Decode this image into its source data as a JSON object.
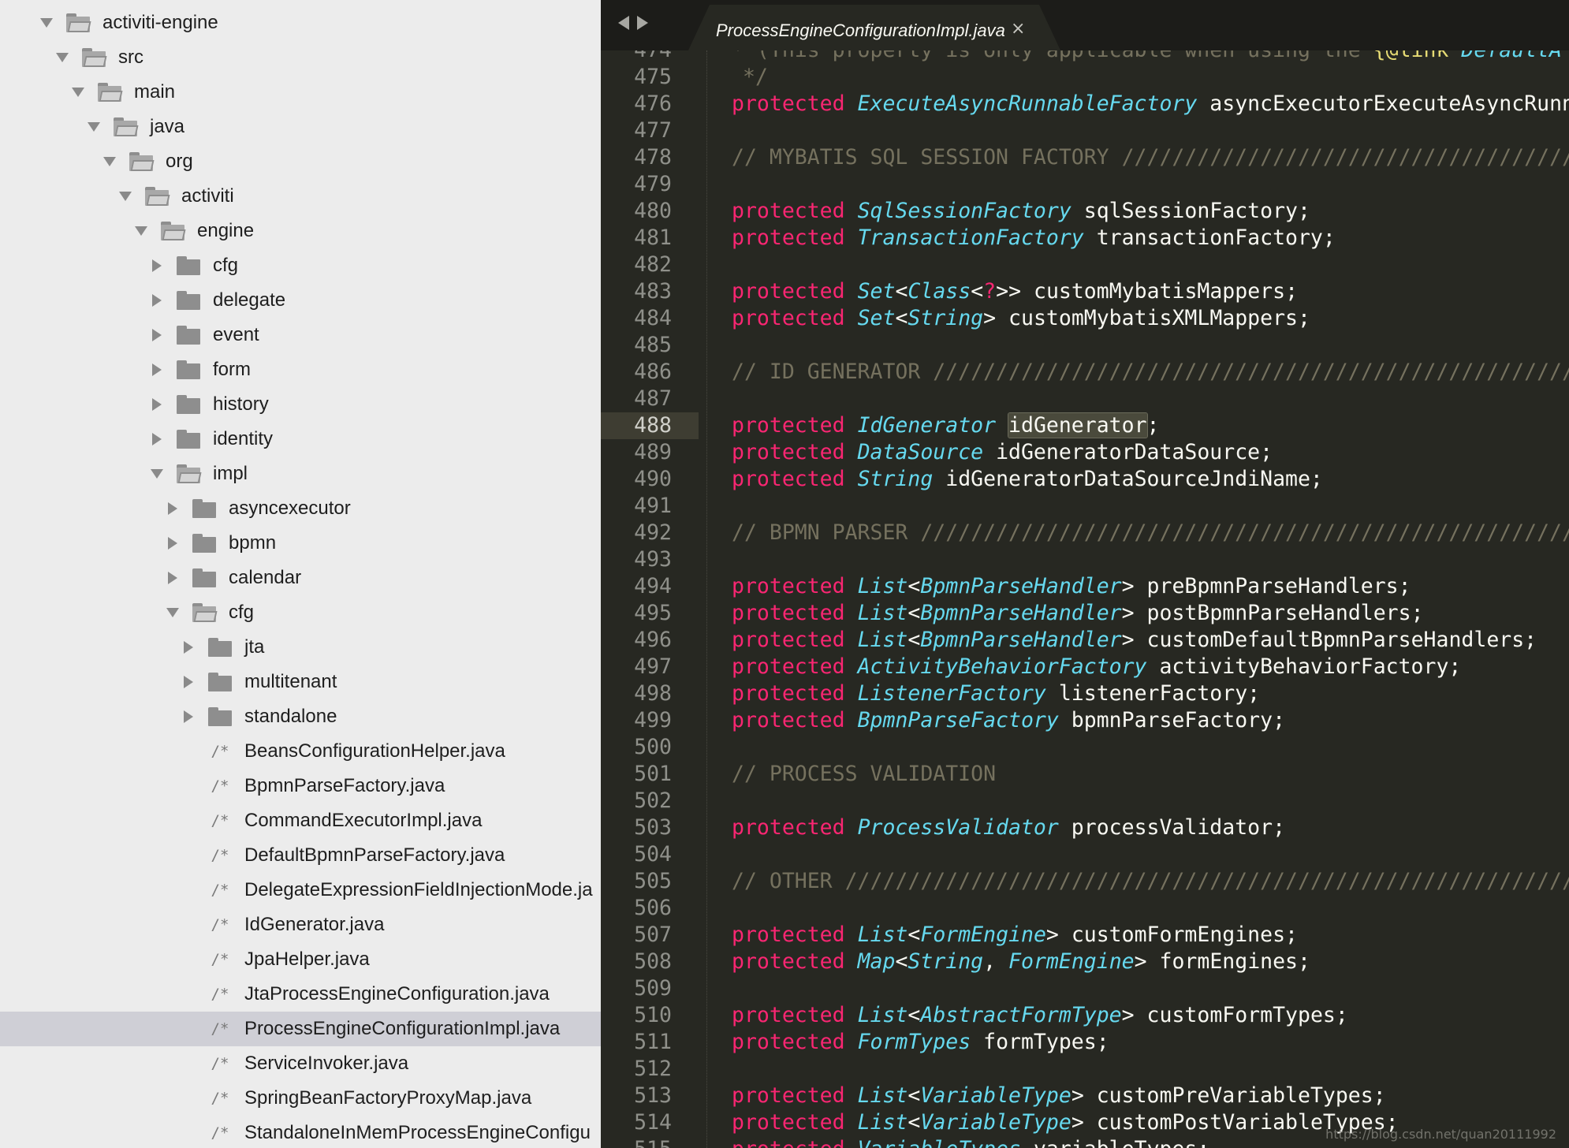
{
  "sidebar": {
    "items": [
      {
        "label": "activiti-engine",
        "kind": "folder",
        "open": true,
        "depth": 0
      },
      {
        "label": "src",
        "kind": "folder",
        "open": true,
        "depth": 1
      },
      {
        "label": "main",
        "kind": "folder",
        "open": true,
        "depth": 2
      },
      {
        "label": "java",
        "kind": "folder",
        "open": true,
        "depth": 3
      },
      {
        "label": "org",
        "kind": "folder",
        "open": true,
        "depth": 4
      },
      {
        "label": "activiti",
        "kind": "folder",
        "open": true,
        "depth": 5
      },
      {
        "label": "engine",
        "kind": "folder",
        "open": true,
        "depth": 6
      },
      {
        "label": "cfg",
        "kind": "folder",
        "open": false,
        "depth": 7
      },
      {
        "label": "delegate",
        "kind": "folder",
        "open": false,
        "depth": 7
      },
      {
        "label": "event",
        "kind": "folder",
        "open": false,
        "depth": 7
      },
      {
        "label": "form",
        "kind": "folder",
        "open": false,
        "depth": 7
      },
      {
        "label": "history",
        "kind": "folder",
        "open": false,
        "depth": 7
      },
      {
        "label": "identity",
        "kind": "folder",
        "open": false,
        "depth": 7
      },
      {
        "label": "impl",
        "kind": "folder",
        "open": true,
        "depth": 7
      },
      {
        "label": "asyncexecutor",
        "kind": "folder",
        "open": false,
        "depth": 8
      },
      {
        "label": "bpmn",
        "kind": "folder",
        "open": false,
        "depth": 8
      },
      {
        "label": "calendar",
        "kind": "folder",
        "open": false,
        "depth": 8
      },
      {
        "label": "cfg",
        "kind": "folder",
        "open": true,
        "depth": 8
      },
      {
        "label": "jta",
        "kind": "folder",
        "open": false,
        "depth": 9
      },
      {
        "label": "multitenant",
        "kind": "folder",
        "open": false,
        "depth": 9
      },
      {
        "label": "standalone",
        "kind": "folder",
        "open": false,
        "depth": 9
      },
      {
        "label": "BeansConfigurationHelper.java",
        "kind": "file",
        "depth": 9
      },
      {
        "label": "BpmnParseFactory.java",
        "kind": "file",
        "depth": 9
      },
      {
        "label": "CommandExecutorImpl.java",
        "kind": "file",
        "depth": 9
      },
      {
        "label": "DefaultBpmnParseFactory.java",
        "kind": "file",
        "depth": 9
      },
      {
        "label": "DelegateExpressionFieldInjectionMode.ja",
        "kind": "file",
        "depth": 9
      },
      {
        "label": "IdGenerator.java",
        "kind": "file",
        "depth": 9
      },
      {
        "label": "JpaHelper.java",
        "kind": "file",
        "depth": 9
      },
      {
        "label": "JtaProcessEngineConfiguration.java",
        "kind": "file",
        "depth": 9
      },
      {
        "label": "ProcessEngineConfigurationImpl.java",
        "kind": "file",
        "depth": 9,
        "selected": true
      },
      {
        "label": "ServiceInvoker.java",
        "kind": "file",
        "depth": 9
      },
      {
        "label": "SpringBeanFactoryProxyMap.java",
        "kind": "file",
        "depth": 9
      },
      {
        "label": "StandaloneInMemProcessEngineConfigu",
        "kind": "file",
        "depth": 9
      }
    ],
    "file_icon_glyph": "/*",
    "icons": {
      "folder": "folder-icon",
      "folder_open": "folder-open-icon",
      "file": "source-file-icon",
      "expand": "disclosure-triangle-icon"
    }
  },
  "tab": {
    "title": "ProcessEngineConfigurationImpl.java",
    "close_glyph": "×",
    "back_icon": "nav-back-icon",
    "forward_icon": "nav-forward-icon"
  },
  "editor": {
    "current_line": 488,
    "lines": [
      {
        "n": 474,
        "t": [
          [
            "cm",
            "* (This property is only applicable when using the "
          ],
          [
            "ti",
            "{@link"
          ],
          [
            "ty",
            " DefaultA"
          ]
        ]
      },
      {
        "n": 475,
        "t": [
          [
            "cm",
            "*/"
          ]
        ],
        "indent": true
      },
      {
        "n": 476,
        "t": [
          [
            "kw",
            "protected"
          ],
          [
            "p",
            " "
          ],
          [
            "ty",
            "ExecuteAsyncRunnableFactory"
          ],
          [
            "p",
            " asyncExecutorExecuteAsyncRunn"
          ]
        ]
      },
      {
        "n": 477,
        "t": []
      },
      {
        "n": 478,
        "t": [
          [
            "cm",
            "// MYBATIS SQL SESSION FACTORY //////////////////////////////////////"
          ]
        ]
      },
      {
        "n": 479,
        "t": []
      },
      {
        "n": 480,
        "t": [
          [
            "kw",
            "protected"
          ],
          [
            "p",
            " "
          ],
          [
            "ty",
            "SqlSessionFactory"
          ],
          [
            "p",
            " sqlSessionFactory;"
          ]
        ]
      },
      {
        "n": 481,
        "t": [
          [
            "kw",
            "protected"
          ],
          [
            "p",
            " "
          ],
          [
            "ty",
            "TransactionFactory"
          ],
          [
            "p",
            " transactionFactory;"
          ]
        ]
      },
      {
        "n": 482,
        "t": []
      },
      {
        "n": 483,
        "t": [
          [
            "kw",
            "protected"
          ],
          [
            "p",
            " "
          ],
          [
            "ty",
            "Set"
          ],
          [
            "p",
            "<"
          ],
          [
            "ty",
            "Class"
          ],
          [
            "p",
            "<"
          ],
          [
            "kw",
            "?"
          ],
          [
            "p",
            ">> customMybatisMappers;"
          ]
        ]
      },
      {
        "n": 484,
        "t": [
          [
            "kw",
            "protected"
          ],
          [
            "p",
            " "
          ],
          [
            "ty",
            "Set"
          ],
          [
            "p",
            "<"
          ],
          [
            "ty",
            "String"
          ],
          [
            "p",
            "> customMybatisXMLMappers;"
          ]
        ]
      },
      {
        "n": 485,
        "t": []
      },
      {
        "n": 486,
        "t": [
          [
            "cm",
            "// ID GENERATOR ///////////////////////////////////////////////////////"
          ]
        ]
      },
      {
        "n": 487,
        "t": []
      },
      {
        "n": 488,
        "t": [
          [
            "kw",
            "protected"
          ],
          [
            "p",
            " "
          ],
          [
            "ty",
            "IdGenerator"
          ],
          [
            "p",
            " "
          ],
          [
            "hl",
            "idGenerator"
          ],
          [
            "p",
            ";"
          ]
        ]
      },
      {
        "n": 489,
        "t": [
          [
            "kw",
            "protected"
          ],
          [
            "p",
            " "
          ],
          [
            "ty",
            "DataSource"
          ],
          [
            "p",
            " idGeneratorDataSource;"
          ]
        ]
      },
      {
        "n": 490,
        "t": [
          [
            "kw",
            "protected"
          ],
          [
            "p",
            " "
          ],
          [
            "ty",
            "String"
          ],
          [
            "p",
            " idGeneratorDataSourceJndiName;"
          ]
        ]
      },
      {
        "n": 491,
        "t": []
      },
      {
        "n": 492,
        "t": [
          [
            "cm",
            "// BPMN PARSER /////////////////////////////////////////////////////////"
          ]
        ]
      },
      {
        "n": 493,
        "t": []
      },
      {
        "n": 494,
        "t": [
          [
            "kw",
            "protected"
          ],
          [
            "p",
            " "
          ],
          [
            "ty",
            "List"
          ],
          [
            "p",
            "<"
          ],
          [
            "ty",
            "BpmnParseHandler"
          ],
          [
            "p",
            "> preBpmnParseHandlers;"
          ]
        ]
      },
      {
        "n": 495,
        "t": [
          [
            "kw",
            "protected"
          ],
          [
            "p",
            " "
          ],
          [
            "ty",
            "List"
          ],
          [
            "p",
            "<"
          ],
          [
            "ty",
            "BpmnParseHandler"
          ],
          [
            "p",
            "> postBpmnParseHandlers;"
          ]
        ]
      },
      {
        "n": 496,
        "t": [
          [
            "kw",
            "protected"
          ],
          [
            "p",
            " "
          ],
          [
            "ty",
            "List"
          ],
          [
            "p",
            "<"
          ],
          [
            "ty",
            "BpmnParseHandler"
          ],
          [
            "p",
            "> customDefaultBpmnParseHandlers;"
          ]
        ]
      },
      {
        "n": 497,
        "t": [
          [
            "kw",
            "protected"
          ],
          [
            "p",
            " "
          ],
          [
            "ty",
            "ActivityBehaviorFactory"
          ],
          [
            "p",
            " activityBehaviorFactory;"
          ]
        ]
      },
      {
        "n": 498,
        "t": [
          [
            "kw",
            "protected"
          ],
          [
            "p",
            " "
          ],
          [
            "ty",
            "ListenerFactory"
          ],
          [
            "p",
            " listenerFactory;"
          ]
        ]
      },
      {
        "n": 499,
        "t": [
          [
            "kw",
            "protected"
          ],
          [
            "p",
            " "
          ],
          [
            "ty",
            "BpmnParseFactory"
          ],
          [
            "p",
            " bpmnParseFactory;"
          ]
        ]
      },
      {
        "n": 500,
        "t": []
      },
      {
        "n": 501,
        "t": [
          [
            "cm",
            "// PROCESS VALIDATION"
          ]
        ]
      },
      {
        "n": 502,
        "t": []
      },
      {
        "n": 503,
        "t": [
          [
            "kw",
            "protected"
          ],
          [
            "p",
            " "
          ],
          [
            "ty",
            "ProcessValidator"
          ],
          [
            "p",
            " processValidator;"
          ]
        ]
      },
      {
        "n": 504,
        "t": []
      },
      {
        "n": 505,
        "t": [
          [
            "cm",
            "// OTHER ///////////////////////////////////////////////////////////////"
          ]
        ]
      },
      {
        "n": 506,
        "t": []
      },
      {
        "n": 507,
        "t": [
          [
            "kw",
            "protected"
          ],
          [
            "p",
            " "
          ],
          [
            "ty",
            "List"
          ],
          [
            "p",
            "<"
          ],
          [
            "ty",
            "FormEngine"
          ],
          [
            "p",
            "> customFormEngines;"
          ]
        ]
      },
      {
        "n": 508,
        "t": [
          [
            "kw",
            "protected"
          ],
          [
            "p",
            " "
          ],
          [
            "ty",
            "Map"
          ],
          [
            "p",
            "<"
          ],
          [
            "ty",
            "String"
          ],
          [
            "p",
            ", "
          ],
          [
            "ty",
            "FormEngine"
          ],
          [
            "p",
            "> formEngines;"
          ]
        ]
      },
      {
        "n": 509,
        "t": []
      },
      {
        "n": 510,
        "t": [
          [
            "kw",
            "protected"
          ],
          [
            "p",
            " "
          ],
          [
            "ty",
            "List"
          ],
          [
            "p",
            "<"
          ],
          [
            "ty",
            "AbstractFormType"
          ],
          [
            "p",
            "> customFormTypes;"
          ]
        ]
      },
      {
        "n": 511,
        "t": [
          [
            "kw",
            "protected"
          ],
          [
            "p",
            " "
          ],
          [
            "ty",
            "FormTypes"
          ],
          [
            "p",
            " formTypes;"
          ]
        ]
      },
      {
        "n": 512,
        "t": []
      },
      {
        "n": 513,
        "t": [
          [
            "kw",
            "protected"
          ],
          [
            "p",
            " "
          ],
          [
            "ty",
            "List"
          ],
          [
            "p",
            "<"
          ],
          [
            "ty",
            "VariableType"
          ],
          [
            "p",
            "> customPreVariableTypes;"
          ]
        ]
      },
      {
        "n": 514,
        "t": [
          [
            "kw",
            "protected"
          ],
          [
            "p",
            " "
          ],
          [
            "ty",
            "List"
          ],
          [
            "p",
            "<"
          ],
          [
            "ty",
            "VariableType"
          ],
          [
            "p",
            "> customPostVariableTypes;"
          ]
        ]
      },
      {
        "n": 515,
        "t": [
          [
            "kw",
            "protected"
          ],
          [
            "p",
            " "
          ],
          [
            "ty",
            "VariableTypes"
          ],
          [
            "p",
            " variableTypes;"
          ]
        ]
      }
    ]
  },
  "watermark": "https://blog.csdn.net/quan20111992",
  "colors": {
    "keyword": "#f92672",
    "type": "#66d9ef",
    "comment": "#75715e",
    "plain": "#f8f8f2",
    "editor_bg": "#272822",
    "sidebar_bg": "#ececec"
  }
}
